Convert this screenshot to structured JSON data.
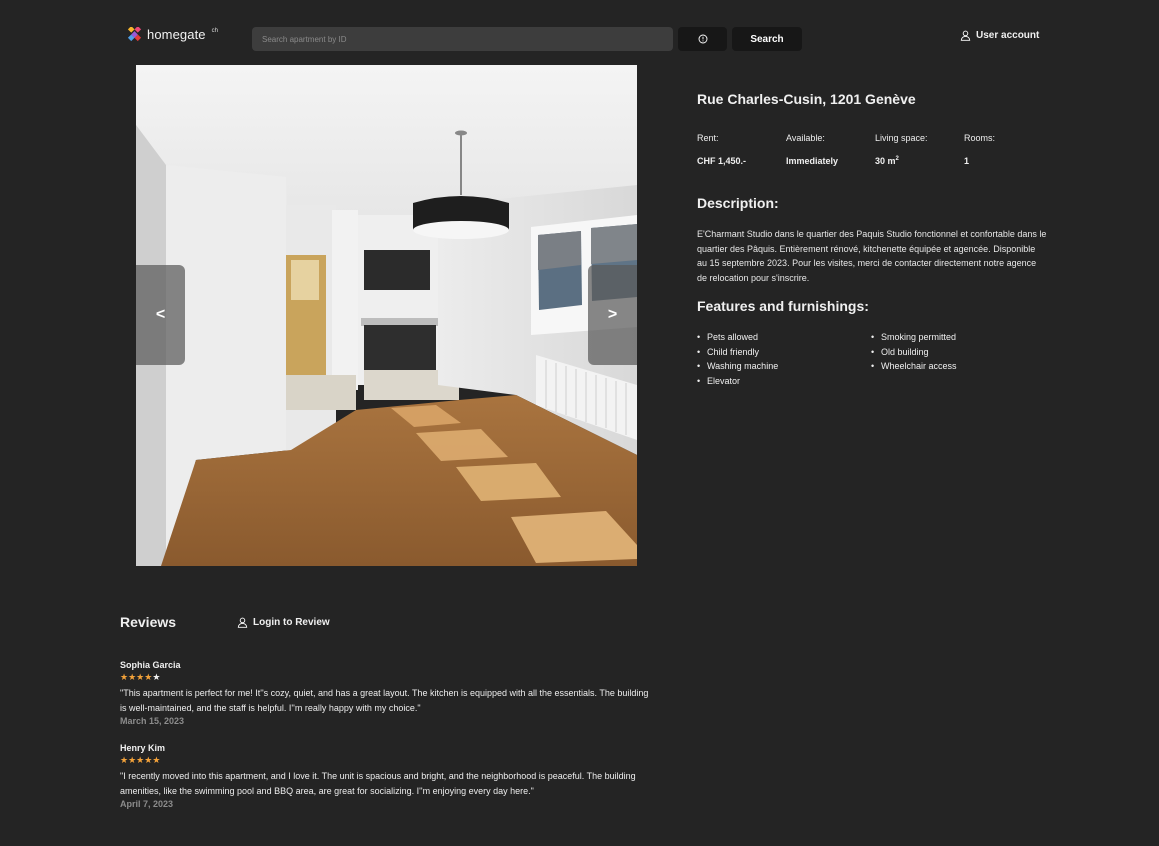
{
  "header": {
    "logo_text": "homegate",
    "logo_tld": "ch",
    "search_placeholder": "Search apartment by ID",
    "search_label": "Search",
    "user_account_label": "User account"
  },
  "gallery": {
    "prev_label": "<",
    "next_label": ">"
  },
  "listing": {
    "address": "Rue Charles-Cusin, 1201 Genève",
    "facts": [
      {
        "label": "Rent:",
        "value": "CHF 1,450.-"
      },
      {
        "label": "Available:",
        "value": "Immediately"
      },
      {
        "label": "Living space:",
        "value": "30 m",
        "unit_sup": "2"
      },
      {
        "label": "Rooms:",
        "value": "1"
      }
    ],
    "description_title": "Description:",
    "description": "E'Charmant Studio dans le quartier des Paquis Studio fonctionnel et confortable dans le quartier des Pâquis. Entièrement rénové, kitchenette équipée et agencée. Disponible au 15 septembre 2023. Pour les visites, merci de contacter directement notre agence de relocation pour s'inscrire.",
    "features_title": "Features and furnishings:",
    "features_left": [
      "Pets allowed",
      "Child friendly",
      "Washing machine",
      "Elevator"
    ],
    "features_right": [
      "Smoking permitted",
      "Old building",
      "Wheelchair access"
    ]
  },
  "reviews": {
    "title": "Reviews",
    "login_label": "Login to Review",
    "items": [
      {
        "name": "Sophia Garcia",
        "rating": 4,
        "text": "\"This apartment is perfect for me! It''s cozy, quiet, and has a great layout. The kitchen is equipped with all the essentials. The building is well-maintained, and the staff is helpful. I''m really happy with my choice.\"",
        "date": "March 15, 2023"
      },
      {
        "name": "Henry Kim",
        "rating": 5,
        "text": "\"I recently moved into this apartment, and I love it. The unit is spacious and bright, and the neighborhood is peaceful. The building amenities, like the swimming pool and BBQ area, are great for socializing. I''m enjoying every day here.\"",
        "date": "April 7, 2023"
      }
    ]
  },
  "colors": {
    "background": "#242424",
    "star_on": "#f3a23a",
    "date": "#8c8c8c"
  }
}
